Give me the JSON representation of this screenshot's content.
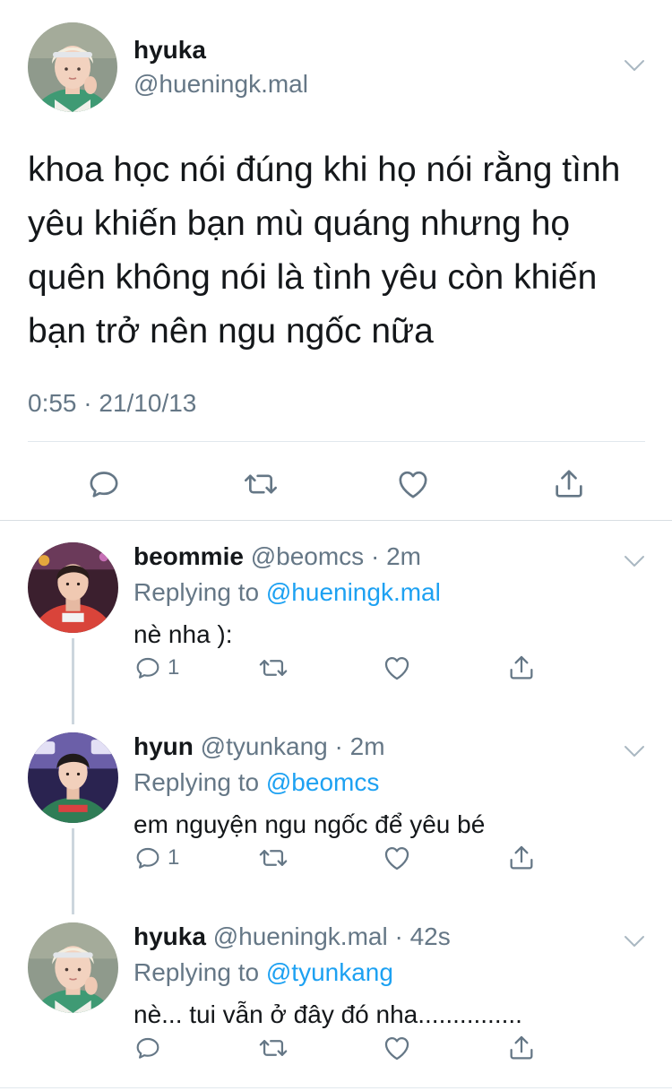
{
  "main_tweet": {
    "display_name": "hyuka",
    "handle": "@hueningk.mal",
    "text": "khoa học nói đúng khi họ nói rằng tình yêu khiến bạn mù quáng nhưng họ quên không nói là tình yêu còn khiến bạn trở nên ngu ngốc nữa",
    "timestamp": "0:55 · 21/10/13"
  },
  "replies": [
    {
      "display_name": "beommie",
      "meta": "@beomcs · 2m",
      "replying_prefix": "Replying to ",
      "replying_to": "@hueningk.mal",
      "text": "nè nha ):",
      "reply_count": "1"
    },
    {
      "display_name": "hyun",
      "meta": "@tyunkang · 2m",
      "replying_prefix": "Replying to ",
      "replying_to": "@beomcs",
      "text": "em nguyện ngu ngốc để yêu bé",
      "reply_count": "1"
    },
    {
      "display_name": "hyuka",
      "meta": "@hueningk.mal · 42s",
      "replying_prefix": "Replying to ",
      "replying_to": "@tyunkang",
      "text": "nè... tui vẫn ở đây đó nha...............",
      "reply_count": ""
    }
  ],
  "icons": {
    "reply": "reply-icon",
    "retweet": "retweet-icon",
    "like": "heart-icon",
    "share": "share-icon",
    "more": "chevron-down-icon"
  },
  "colors": {
    "text": "#14171a",
    "secondary": "#657786",
    "link": "#1da1f2",
    "divider": "#e1e8ed"
  }
}
